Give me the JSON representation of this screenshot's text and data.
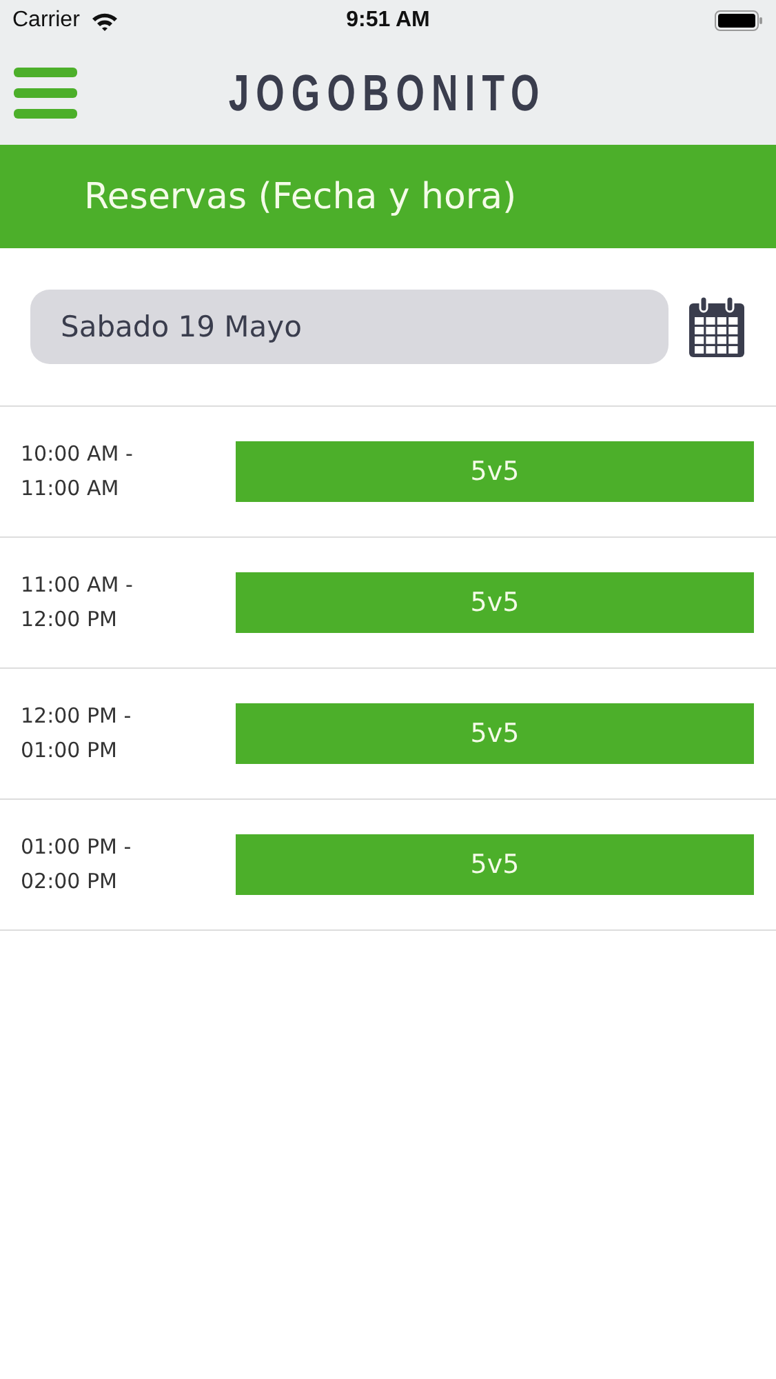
{
  "status_bar": {
    "carrier": "Carrier",
    "time": "9:51 AM"
  },
  "header": {
    "logo": "JOGOBONITO"
  },
  "title_bar": {
    "title": "Reservas (Fecha y hora)"
  },
  "date_field": {
    "value": "Sabado 19 Mayo"
  },
  "slots": [
    {
      "time": "10:00 AM - 11:00 AM",
      "button": "5v5"
    },
    {
      "time": "11:00 AM - 12:00 PM",
      "button": "5v5"
    },
    {
      "time": "12:00 PM - 01:00 PM",
      "button": "5v5"
    },
    {
      "time": "01:00 PM - 02:00 PM",
      "button": "5v5"
    }
  ]
}
